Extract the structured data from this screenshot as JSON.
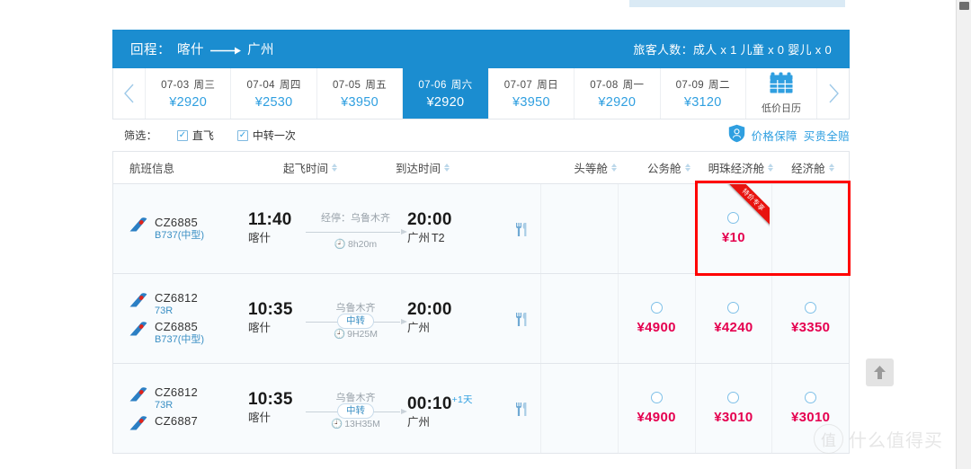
{
  "header": {
    "route_label": "回程：",
    "origin": "喀什",
    "destination": "广州",
    "arrow_icon": "long-arrow-right-icon",
    "passengers": "旅客人数：成人 x 1 儿童 x 0 婴儿 x 0"
  },
  "dates": {
    "prev_icon": "chevron-left-icon",
    "next_icon": "chevron-right-icon",
    "cells": [
      {
        "date": "07-03",
        "dow": "周三",
        "price": "¥2920",
        "active": false
      },
      {
        "date": "07-04",
        "dow": "周四",
        "price": "¥2530",
        "active": false
      },
      {
        "date": "07-05",
        "dow": "周五",
        "price": "¥3950",
        "active": false
      },
      {
        "date": "07-06",
        "dow": "周六",
        "price": "¥2920",
        "active": true
      },
      {
        "date": "07-07",
        "dow": "周日",
        "price": "¥3950",
        "active": false
      },
      {
        "date": "07-08",
        "dow": "周一",
        "price": "¥2920",
        "active": false
      },
      {
        "date": "07-09",
        "dow": "周二",
        "price": "¥3120",
        "active": false
      }
    ],
    "calendar": {
      "icon": "calendar-icon",
      "label": "低价日历"
    }
  },
  "filters": {
    "label": "筛选：",
    "items": [
      {
        "label": "直飞",
        "checked": true
      },
      {
        "label": "中转一次",
        "checked": true
      }
    ],
    "price_guard": {
      "icon": "shield-guard-icon",
      "text_primary": "价格保障",
      "text_secondary": "买贵全赔"
    }
  },
  "table": {
    "columns": [
      {
        "label": "航班信息",
        "sortable": false
      },
      {
        "label": "起飞时间",
        "sortable": true
      },
      {
        "label": "到达时间",
        "sortable": true
      },
      {
        "label": "头等舱",
        "sortable": true
      },
      {
        "label": "公务舱",
        "sortable": true
      },
      {
        "label": "明珠经济舱",
        "sortable": true
      },
      {
        "label": "经济舱",
        "sortable": true
      }
    ]
  },
  "flights": [
    {
      "segments": [
        {
          "flight_no": "CZ6885",
          "aircraft": "B737(中型)",
          "airline_logo": "china-southern-logo"
        }
      ],
      "depart_time": "11:40",
      "depart_city": "喀什",
      "arrive_time": "20:00",
      "arrive_city": "广州",
      "arrive_terminal": "T2",
      "arrive_day_offset": "",
      "via_label": "经停：乌鲁木齐",
      "transfer_pill": "",
      "duration": "8h20m",
      "meal_icon": "meal-icon",
      "cabins": [
        {
          "name": "头等舱",
          "price": "",
          "radio": false
        },
        {
          "name": "公务舱",
          "price": "",
          "radio": false
        },
        {
          "name": "明珠经济舱",
          "price": "¥10",
          "radio": true
        },
        {
          "name": "经济舱",
          "price": "",
          "radio": false
        }
      ],
      "highlight": {
        "active": true,
        "ribbon_text": "特价专享",
        "ribbon_color": "#e8130f",
        "border_color": "#ff0000"
      }
    },
    {
      "segments": [
        {
          "flight_no": "CZ6812",
          "aircraft": "73R",
          "airline_logo": "china-southern-logo"
        },
        {
          "flight_no": "CZ6885",
          "aircraft": "B737(中型)",
          "airline_logo": "china-southern-logo"
        }
      ],
      "depart_time": "10:35",
      "depart_city": "喀什",
      "arrive_time": "20:00",
      "arrive_city": "广州",
      "arrive_terminal": "",
      "arrive_day_offset": "",
      "via_label": "乌鲁木齐",
      "transfer_pill": "中转",
      "duration": "9H25M",
      "meal_icon": "meal-icon",
      "cabins": [
        {
          "name": "头等舱",
          "price": "",
          "radio": false
        },
        {
          "name": "公务舱",
          "price": "¥4900",
          "radio": true
        },
        {
          "name": "明珠经济舱",
          "price": "¥4240",
          "radio": true
        },
        {
          "name": "经济舱",
          "price": "¥3350",
          "radio": true
        }
      ],
      "highlight": {
        "active": false,
        "ribbon_text": "",
        "ribbon_color": "",
        "border_color": ""
      }
    },
    {
      "segments": [
        {
          "flight_no": "CZ6812",
          "aircraft": "73R",
          "airline_logo": "china-southern-logo"
        },
        {
          "flight_no": "CZ6887",
          "aircraft": "",
          "airline_logo": "china-southern-logo"
        }
      ],
      "depart_time": "10:35",
      "depart_city": "喀什",
      "arrive_time": "00:10",
      "arrive_city": "广州",
      "arrive_terminal": "",
      "arrive_day_offset": "+1天",
      "via_label": "乌鲁木齐",
      "transfer_pill": "中转",
      "duration": "13H35M",
      "meal_icon": "meal-icon",
      "cabins": [
        {
          "name": "头等舱",
          "price": "",
          "radio": false
        },
        {
          "name": "公务舱",
          "price": "¥4900",
          "radio": true
        },
        {
          "name": "明珠经济舱",
          "price": "¥3010",
          "radio": true
        },
        {
          "name": "经济舱",
          "price": "¥3010",
          "radio": true
        }
      ],
      "highlight": {
        "active": false,
        "ribbon_text": "",
        "ribbon_color": "",
        "border_color": ""
      }
    }
  ],
  "back_to_top": {
    "icon": "arrow-up-icon"
  },
  "watermark": {
    "mark": "值",
    "text": "什么值得买"
  },
  "colors": {
    "brand_blue": "#1b8dd0",
    "link_blue": "#2f9fe0",
    "price_red": "#e5004f",
    "highlight_red": "#ff0000",
    "row_bg": "#f8fbfd",
    "border": "#e2e6eb"
  }
}
